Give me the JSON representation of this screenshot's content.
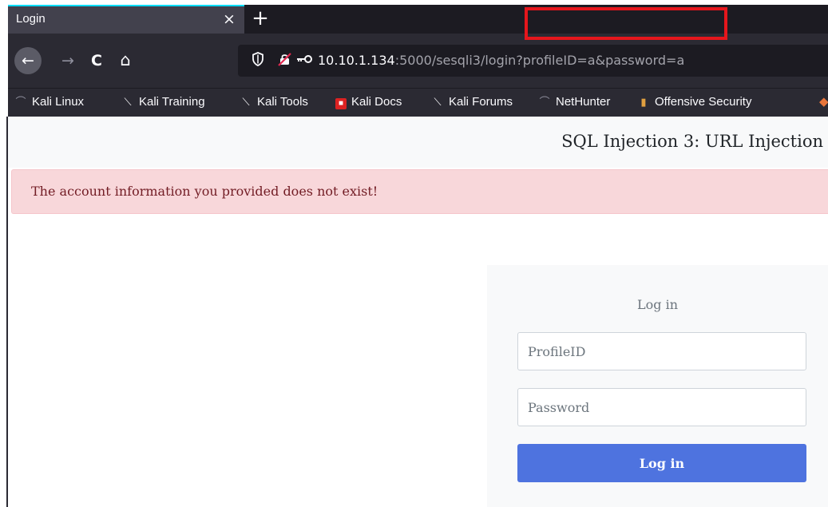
{
  "browser": {
    "tab": {
      "title": "Login",
      "close_glyph": "×"
    },
    "new_tab_glyph": "+",
    "nav": {
      "back_icon": "←",
      "forward_icon": "→",
      "reload_icon": "C",
      "home_icon": "⌂"
    },
    "url": {
      "host": "10.10.1.134",
      "rest": ":5000/sesqli3/login?profileID=a&password=a"
    },
    "bookmarks": [
      {
        "label": "Kali Linux",
        "icon": "kali-dragon-icon"
      },
      {
        "label": "Kali Training",
        "icon": "kali-dragon-icon"
      },
      {
        "label": "Kali Tools",
        "icon": "kali-dragon-icon"
      },
      {
        "label": "Kali Docs",
        "icon": "docs-icon"
      },
      {
        "label": "Kali Forums",
        "icon": "kali-dragon-icon"
      },
      {
        "label": "NetHunter",
        "icon": "kali-dragon-icon"
      },
      {
        "label": "Offensive Security",
        "icon": "offsec-icon"
      }
    ]
  },
  "page": {
    "title": "SQL Injection 3: URL Injection",
    "alert": "The account information you provided does not exist!",
    "login": {
      "heading": "Log in",
      "profile_placeholder": "ProfileID",
      "password_placeholder": "Password",
      "submit_label": "Log in"
    }
  },
  "colors": {
    "tab_accent": "#00ddff",
    "highlight": "#e5161c",
    "alert_bg": "#f8d7da",
    "alert_text": "#721c24",
    "button": "#4e73df"
  }
}
